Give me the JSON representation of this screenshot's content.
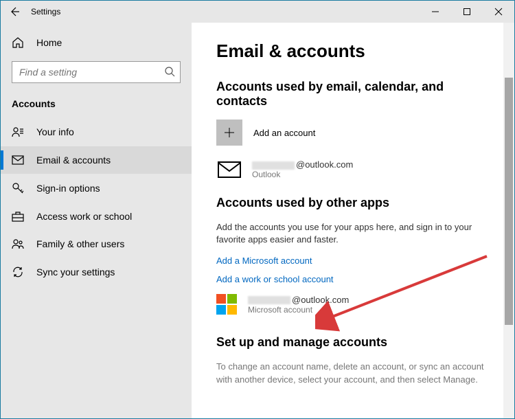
{
  "titlebar": {
    "title": "Settings"
  },
  "sidebar": {
    "home": "Home",
    "search_placeholder": "Find a setting",
    "section": "Accounts",
    "items": [
      {
        "label": "Your info"
      },
      {
        "label": "Email & accounts"
      },
      {
        "label": "Sign-in options"
      },
      {
        "label": "Access work or school"
      },
      {
        "label": "Family & other users"
      },
      {
        "label": "Sync your settings"
      }
    ]
  },
  "main": {
    "heading": "Email & accounts",
    "section1_title": "Accounts used by email, calendar, and contacts",
    "add_account": "Add an account",
    "outlook_suffix": "@outlook.com",
    "outlook_provider": "Outlook",
    "section2_title": "Accounts used by other apps",
    "section2_desc": "Add the accounts you use for your apps here, and sign in to your favorite apps easier and faster.",
    "link_ms": "Add a Microsoft account",
    "link_work": "Add a work or school account",
    "ms_suffix": "@outlook.com",
    "ms_provider": "Microsoft account",
    "section3_title": "Set up and manage accounts",
    "section3_desc": "To change an account name, delete an account, or sync an account with another device, select your account, and then select Manage."
  }
}
